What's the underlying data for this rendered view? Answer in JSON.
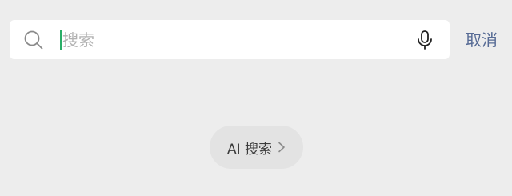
{
  "search": {
    "placeholder": "搜索",
    "value": ""
  },
  "cancel_label": "取消",
  "ai_search": {
    "label": "AI 搜索"
  },
  "icons": {
    "search": "search-icon",
    "microphone": "microphone-icon",
    "chevron": "chevron-right-icon"
  },
  "colors": {
    "background": "#ededed",
    "search_box": "#ffffff",
    "caret": "#2aae67",
    "link": "#576b95",
    "placeholder": "#b2b2b2",
    "pill": "#e3e3e3"
  }
}
